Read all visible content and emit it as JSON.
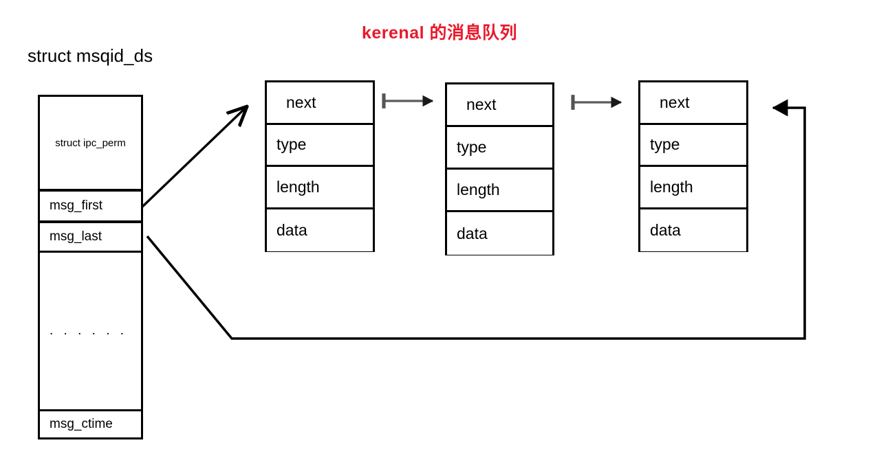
{
  "title": "kerenal 的消息队列",
  "struct": {
    "label": "struct msqid_ds",
    "rows": [
      {
        "name": "ipc-perm",
        "label": "struct  ipc_perm"
      },
      {
        "name": "msg-first",
        "label": "msg_first"
      },
      {
        "name": "msg-last",
        "label": "msg_last"
      },
      {
        "name": "ellipsis",
        "label": ". . . . . ."
      },
      {
        "name": "msg-ctime",
        "label": "msg_ctime"
      }
    ]
  },
  "messages": [
    {
      "name": "message-node-1",
      "fields": {
        "next": "next",
        "type": "type",
        "length": "length",
        "data": "data"
      }
    },
    {
      "name": "message-node-2",
      "fields": {
        "next": "next",
        "type": "type",
        "length": "length",
        "data": "data"
      }
    },
    {
      "name": "message-node-3",
      "fields": {
        "next": "next",
        "type": "type",
        "length": "length",
        "data": "data"
      }
    }
  ],
  "connectors": [
    {
      "name": "msg-first-pointer-arrow",
      "from": "msg_first",
      "to": "message-node-1"
    },
    {
      "name": "node1-to-node2-arrow",
      "from": "message-node-1",
      "to": "message-node-2"
    },
    {
      "name": "node2-to-node3-arrow",
      "from": "message-node-2",
      "to": "message-node-3"
    },
    {
      "name": "msg-last-pointer-arrow",
      "from": "msg_last",
      "to": "message-node-3"
    }
  ],
  "colors": {
    "title": "#e8192c",
    "stroke": "#000000",
    "link_arrow": "#555555",
    "background": "#ffffff"
  }
}
